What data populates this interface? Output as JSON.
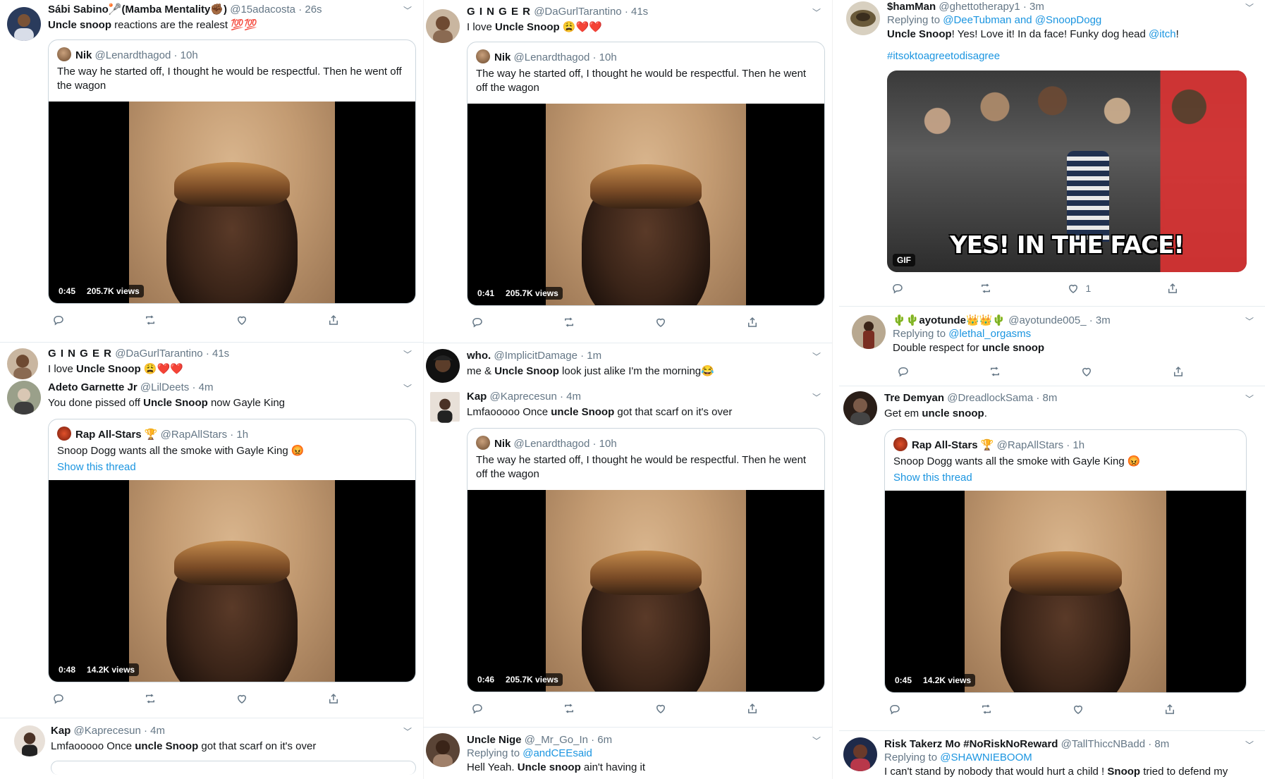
{
  "tweets": [
    {
      "name": "Sábi Sabino🥍(Mamba Mentality✊🏾)",
      "handle": "@15adacosta",
      "time": "· 26s",
      "text_pre": "",
      "text_bold": "Uncle snoop",
      "text_post": " reactions are the realest 💯💯",
      "quote": {
        "name": "Nik",
        "handle": "@Lenardthagod",
        "time": "· 10h",
        "text": "The way he started off, I thought he would be respectful. Then he went off the wagon"
      },
      "video": {
        "duration": "0:45",
        "views": "205.7K views"
      }
    },
    {
      "name": "G I N G E R",
      "handle": "@DaGurlTarantino",
      "time": "· 41s",
      "text_pre": "I love ",
      "text_bold": "Uncle Snoop",
      "text_post": " 😩❤️❤️",
      "quote": {
        "name": "Nik",
        "handle": "@Lenardthagod",
        "time": "· 10h",
        "text": "The way he started off, I thought he would be respectful. Then he went off the wagon"
      },
      "video": {
        "duration": "0:41",
        "views": "205.7K views"
      }
    },
    {
      "name": "$hamMan",
      "handle": "@ghettotherapy1",
      "time": "· 3m",
      "reply_prefix": "Replying to ",
      "reply_to": "@DeeTubman and @SnoopDogg",
      "text_pre": "",
      "text_bold": "Uncle Snoop",
      "text_post": "!  Yes!  Love it!  In da face!  Funky dog head ",
      "text_link": "@itch",
      "text_end": "!",
      "hashtag": "#itsoktoagreetodisagree",
      "gif": {
        "caption": "YES! IN THE FACE!",
        "badge": "GIF"
      },
      "likes": "1"
    },
    {
      "name": "G I N G E R",
      "handle": "@DaGurlTarantino",
      "time": "· 41s",
      "text_pre": "I love ",
      "text_bold": "Uncle Snoop",
      "text_post": " 😩❤️❤️"
    },
    {
      "name": "Adeto Garnette Jr",
      "handle": "@LilDeets",
      "time": "· 4m",
      "text_pre": "You done pissed off ",
      "text_bold": "Uncle Snoop",
      "text_post": " now Gayle King",
      "quote": {
        "name": "Rap All-Stars 🏆",
        "handle": "@RapAllStars",
        "time": "· 1h",
        "text": "Snoop Dogg wants all the smoke with Gayle King 😡",
        "thread": "Show this thread"
      },
      "video": {
        "duration": "0:48",
        "views": "14.2K views"
      }
    },
    {
      "name": "who.",
      "handle": "@ImplicitDamage",
      "time": "· 1m",
      "text_pre": "me & ",
      "text_bold": "Uncle Snoop",
      "text_post": " look just alike I'm the morning😂"
    },
    {
      "name": "Kap",
      "handle": "@Kaprecesun",
      "time": "· 4m",
      "text_pre": "Lmfaooooo Once ",
      "text_bold": "uncle Snoop",
      "text_post": " got that scarf on it's over",
      "quote": {
        "name": "Nik",
        "handle": "@Lenardthagod",
        "time": "· 10h",
        "text": "The way he started off, I thought he would be respectful. Then he went off the wagon"
      },
      "video": {
        "duration": "0:46",
        "views": "205.7K views"
      }
    },
    {
      "name": "🌵🌵ayotunde👑👑🌵",
      "handle": "@ayotunde005_",
      "time": "· 3m",
      "reply_prefix": "Replying to ",
      "reply_to": "@lethal_orgasms",
      "text_pre": "Double respect for ",
      "text_bold": "uncle snoop",
      "text_post": ""
    },
    {
      "name": "Tre Demyan",
      "handle": "@DreadlockSama",
      "time": "· 8m",
      "text_pre": "Get em ",
      "text_bold": "uncle snoop",
      "text_post": ".",
      "quote": {
        "name": "Rap All-Stars 🏆",
        "handle": "@RapAllStars",
        "time": "· 1h",
        "text": "Snoop Dogg wants all the smoke with Gayle King 😡",
        "thread": "Show this thread"
      },
      "video": {
        "duration": "0:45",
        "views": "14.2K views"
      }
    },
    {
      "name": "Kap",
      "handle": "@Kaprecesun",
      "time": "· 4m",
      "text_pre": "Lmfaooooo Once ",
      "text_bold": "uncle Snoop",
      "text_post": " got that scarf on it's over"
    },
    {
      "name": "Uncle Nige",
      "handle": "@_Mr_Go_In",
      "time": "· 6m",
      "reply_prefix": "Replying to ",
      "reply_to": "@andCEEsaid",
      "text_pre": "Hell Yeah. ",
      "text_bold": "Uncle snoop",
      "text_post": " ain't having it"
    },
    {
      "name": "Risk Takerz Mo #NoRiskNoReward",
      "handle": "@TallThiccNBadd",
      "time": "· 8m",
      "reply_prefix": "Replying to ",
      "reply_to": "@SHAWNIEBOOM",
      "text_pre": "I can't stand by nobody that would hurt a child ! ",
      "text_bold": "Snoop",
      "text_post": " tried to defend my"
    }
  ],
  "colors": {
    "link": "#1b95e0",
    "muted": "#657786",
    "border": "#ccd6dd"
  },
  "icons": [
    "reply-icon",
    "retweet-icon",
    "like-icon",
    "share-icon",
    "chevron-down-icon"
  ]
}
